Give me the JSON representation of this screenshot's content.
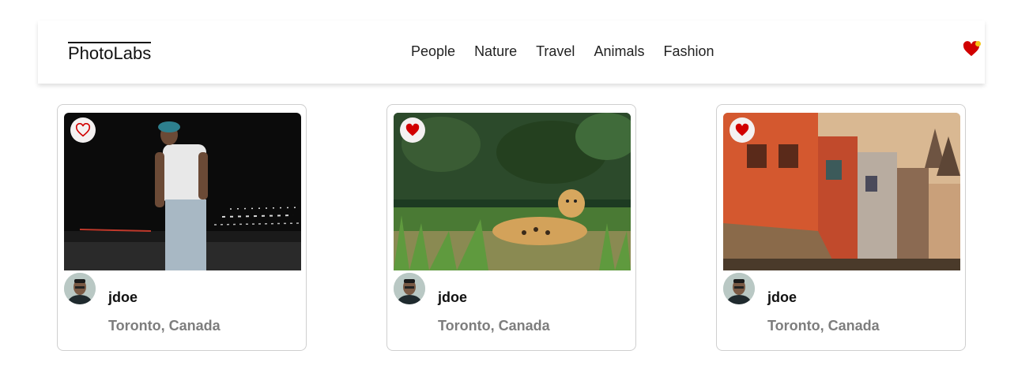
{
  "app": {
    "logo": "PhotoLabs"
  },
  "nav": {
    "topics": [
      "People",
      "Nature",
      "Travel",
      "Animals",
      "Fashion"
    ],
    "fav_icon": "heart-with-notification-icon"
  },
  "colors": {
    "heart_red": "#d10000",
    "notification_yellow": "#f5c518",
    "location_gray": "#7d7d7d"
  },
  "photos": [
    {
      "username": "jdoe",
      "location": "Toronto, Canada",
      "favorited": false,
      "subject": "man walking at night"
    },
    {
      "username": "jdoe",
      "location": "Toronto, Canada",
      "favorited": true,
      "subject": "jaguar resting in grass"
    },
    {
      "username": "jdoe",
      "location": "Toronto, Canada",
      "favorited": true,
      "subject": "colorful old city buildings"
    }
  ]
}
